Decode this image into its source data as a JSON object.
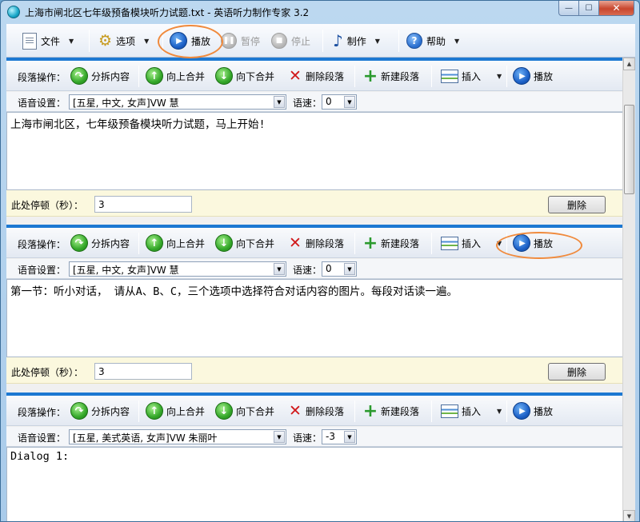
{
  "window": {
    "title": "上海市闸北区七年级预备模块听力试题.txt - 英语听力制作专家 3.2",
    "minimize": "—",
    "maximize": "☐",
    "close": "✕"
  },
  "toolbar": {
    "file": "文件",
    "options": "选项",
    "play": "播放",
    "pause": "暂停",
    "stop": "停止",
    "make": "制作",
    "help": "帮助"
  },
  "segment_labels": {
    "ops": "段落操作：",
    "split": "分拆内容",
    "merge_up": "向上合并",
    "merge_down": "向下合并",
    "delete_para": "删除段落",
    "new_para": "新建段落",
    "insert": "插入",
    "play": "播放",
    "voice": "语音设置：",
    "speed": "语速：",
    "pause": "此处停顿（秒）：",
    "delete": "删除"
  },
  "segments": [
    {
      "voice": "[五星, 中文, 女声]VW 慧",
      "speed": "0",
      "text": "上海市闸北区，七年级预备模块听力试题，马上开始!",
      "pause": "3"
    },
    {
      "voice": "[五星, 中文, 女声]VW 慧",
      "speed": "0",
      "text": "第一节：听小对话， 请从A、B、C，三个选项中选择符合对话内容的图片。每段对话读一遍。",
      "pause": "3"
    },
    {
      "voice": "[五星, 美式英语, 女声]VW 朱丽叶",
      "speed": "-3",
      "text": "Dialog 1:"
    }
  ],
  "annotation_color": "#f08a3c"
}
